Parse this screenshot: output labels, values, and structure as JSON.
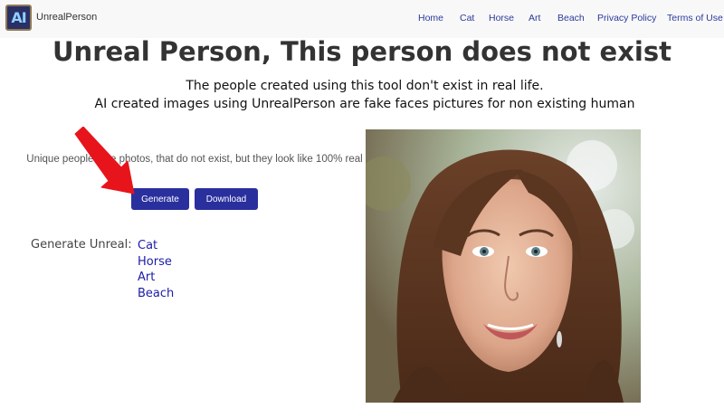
{
  "navbar": {
    "logo_text": "AI",
    "brand": "UnrealPerson",
    "links": [
      "Home",
      "Cat",
      "Horse",
      "Art",
      "Beach",
      "Privacy Policy",
      "Terms of Use"
    ]
  },
  "main": {
    "title": "Unreal Person, This person does not exist",
    "subtitle_line1": "The people created using this tool don't exist in real life.",
    "subtitle_line2": "AI created images using UnrealPerson are fake faces pictures for non existing human",
    "description": "Unique people face photos, that do not exist, but they look like 100% real",
    "generate_button": "Generate",
    "download_button": "Download",
    "generate_label": "Generate Unreal:",
    "generate_links": [
      "Cat",
      "Horse",
      "Art",
      "Beach"
    ]
  },
  "colors": {
    "nav_link": "#2b3a9c",
    "button": "#2a2f9e",
    "link": "#1c1ca6",
    "arrow": "#e8141c"
  },
  "icons": {
    "logo": "ai-logo-icon",
    "arrow": "red-arrow-icon"
  }
}
